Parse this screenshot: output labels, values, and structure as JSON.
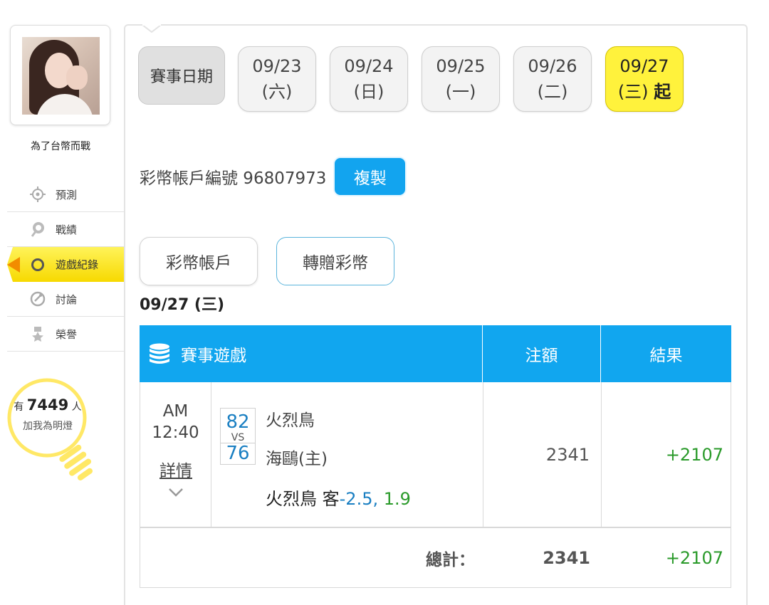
{
  "user": {
    "name": "為了台幣而戰"
  },
  "nav": {
    "items": [
      {
        "label": "預測",
        "icon": "crosshair-icon"
      },
      {
        "label": "戰績",
        "icon": "record-icon"
      },
      {
        "label": "遊戲紀錄",
        "icon": "circle-icon",
        "active": true
      },
      {
        "label": "討論",
        "icon": "discussion-icon"
      },
      {
        "label": "榮譽",
        "icon": "medal-icon"
      }
    ]
  },
  "fans": {
    "prefix": "有",
    "count": "7449",
    "suffix": "人",
    "subtitle": "加我為明燈"
  },
  "dates": {
    "label": "賽事日期",
    "items": [
      {
        "date": "09/23",
        "weekday": "(六)",
        "extra": ""
      },
      {
        "date": "09/24",
        "weekday": "(日)",
        "extra": ""
      },
      {
        "date": "09/25",
        "weekday": "(一)",
        "extra": ""
      },
      {
        "date": "09/26",
        "weekday": "(二)",
        "extra": ""
      },
      {
        "date": "09/27",
        "weekday": "(三)",
        "extra": "起",
        "selected": true
      }
    ]
  },
  "account": {
    "text": "彩幣帳戶編號 96807973",
    "copy_label": "複製"
  },
  "tabs": {
    "account": "彩幣帳戶",
    "transfer": "轉贈彩幣"
  },
  "section_date": "09/27 (三)",
  "table": {
    "headers": {
      "game": "賽事遊戲",
      "bet": "注額",
      "result": "結果"
    },
    "row": {
      "time_period": "AM",
      "time": "12:40",
      "detail_label": "詳情",
      "score_away": "82",
      "vs": "VS",
      "score_home": "76",
      "team_away": "火烈鳥",
      "team_home": "海鷗(主)",
      "pick_team": "火烈鳥 客",
      "pick_line": "-2.5,",
      "pick_odds": " 1.9",
      "bet": "2341",
      "result": "+2107"
    },
    "total": {
      "label": "總計：",
      "bet": "2341",
      "result": "+2107"
    }
  },
  "colors": {
    "header_blue": "#11a6ef",
    "selected_yellow": "#fff23c",
    "win_green": "#2a9a2a",
    "score_blue": "#1a7fc2"
  }
}
